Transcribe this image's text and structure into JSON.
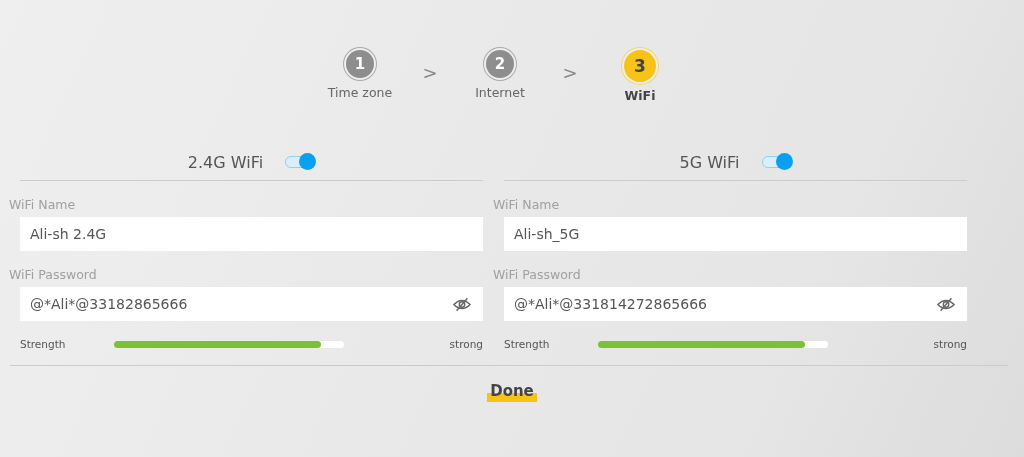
{
  "steps": [
    {
      "number": "1",
      "label": "Time zone",
      "selected": false
    },
    {
      "number": "2",
      "label": "Internet",
      "selected": false
    },
    {
      "number": "3",
      "label": "WiFi",
      "selected": true
    }
  ],
  "separator": ">",
  "bands": [
    {
      "title": "2.4G WiFi",
      "on": true,
      "name_label": "WiFi Name",
      "name_value": "Ali-sh 2.4G",
      "password_label": "WiFi Password",
      "password_value": "@*Ali*@33182865666",
      "strength_label": "Strength",
      "level": 0.9,
      "strength_reading": "strong"
    },
    {
      "title": "5G WiFi",
      "on": true,
      "name_label": "WiFi Name",
      "name_value": "Ali-sh_5G",
      "password_label": "WiFi Password",
      "password_value": "@*Ali*@331814272865666",
      "strength_label": "Strength",
      "level": 0.9,
      "strength_reading": "strong"
    }
  ],
  "done_button": "Done"
}
